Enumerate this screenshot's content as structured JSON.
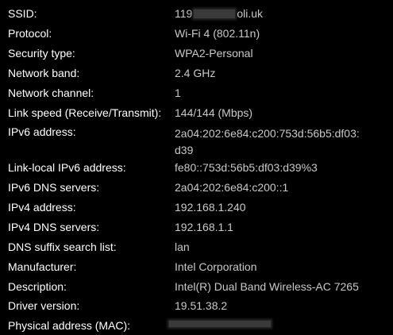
{
  "network_properties": {
    "ssid": {
      "label": "SSID:",
      "value_prefix": "119",
      "value_suffix": "oli.uk"
    },
    "rows": [
      {
        "label": "Protocol:",
        "value": "Wi-Fi 4 (802.11n)"
      },
      {
        "label": "Security type:",
        "value": "WPA2-Personal"
      },
      {
        "label": "Network band:",
        "value": "2.4 GHz"
      },
      {
        "label": "Network channel:",
        "value": "1"
      },
      {
        "label": "Link speed (Receive/Transmit):",
        "value": "144/144 (Mbps)"
      },
      {
        "label": "IPv6 address:",
        "value": "2a04:202:6e84:c200:753d:56b5:df03:d39"
      },
      {
        "label": "Link-local IPv6 address:",
        "value": "fe80::753d:56b5:df03:d39%3"
      },
      {
        "label": "IPv6 DNS servers:",
        "value": "2a04:202:6e84:c200::1"
      },
      {
        "label": "IPv4 address:",
        "value": "192.168.1.240"
      },
      {
        "label": "IPv4 DNS servers:",
        "value": "192.168.1.1"
      },
      {
        "label": "DNS suffix search list:",
        "value": "lan"
      },
      {
        "label": "Manufacturer:",
        "value": "Intel Corporation"
      },
      {
        "label": "Description:",
        "value": "Intel(R) Dual Band Wireless-AC 7265"
      },
      {
        "label": "Driver version:",
        "value": "19.51.38.2"
      }
    ],
    "mac": {
      "label": "Physical address (MAC):"
    }
  },
  "colors": {
    "background": "#000000",
    "label_text": "#ffffff",
    "value_text": "#c8c8c8",
    "redaction": "#3a3a3a"
  }
}
